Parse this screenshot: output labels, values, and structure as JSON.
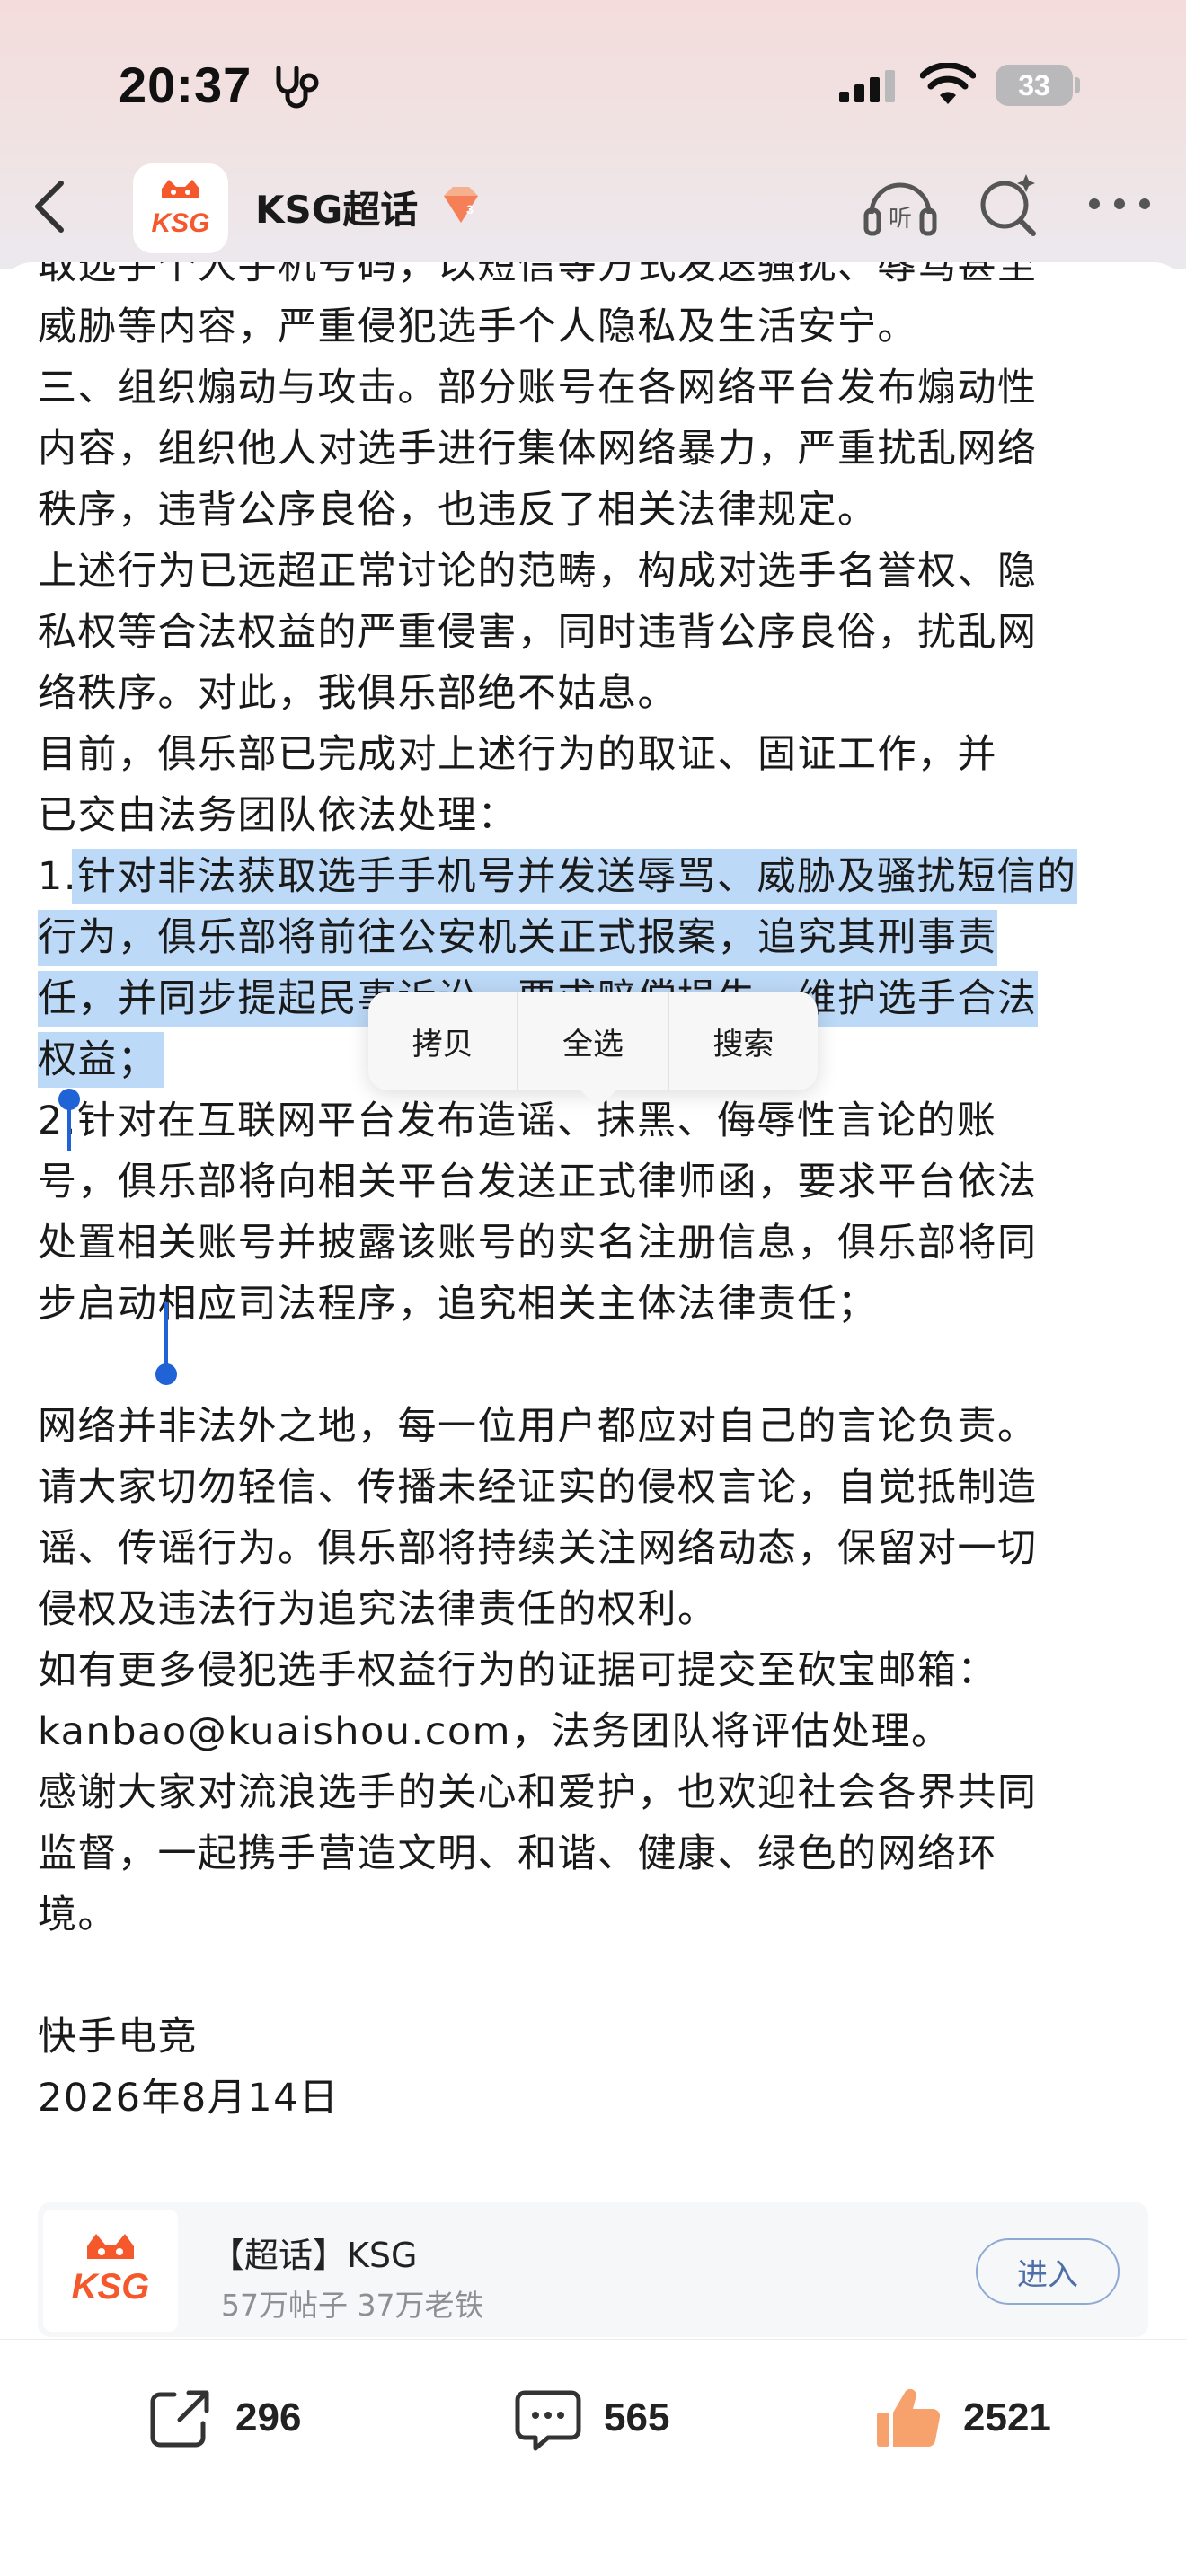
{
  "status_bar": {
    "time": "20:37",
    "battery": "33"
  },
  "nav": {
    "title": "KSG超话",
    "logo_text": "KSG",
    "icons": [
      "back-icon",
      "app-logo",
      "badge-icon",
      "listen-icon",
      "search-sparkle-icon",
      "more-icon"
    ]
  },
  "article": {
    "paragraphs": [
      "取选手个人手机号码，以短信等方式发送骚扰、辱骂甚至\n威胁等内容，严重侵犯选手个人隐私及生活安宁。",
      "三、组织煽动与攻击。部分账号在各网络平台发布煽动性\n内容，组织他人对选手进行集体网络暴力，严重扰乱网络\n秩序，违背公序良俗，也违反了相关法律规定。",
      "上述行为已远超正常讨论的范畴，构成对选手名誉权、隐\n私权等合法权益的严重侵害，同时违背公序良俗，扰乱网\n络秩序。对此，我俱乐部绝不姑息。",
      "目前，俱乐部已完成对上述行为的取证、固证工作，并\n已交由法务团队依法处理："
    ],
    "selected_prefix": "1.",
    "selected_text": "针对非法获取选手手机号并发送辱骂、威胁及骚扰短信的\n行为，俱乐部将前往公安机关正式报案，追究其刑事责\n任，并同步提起民事诉讼，要求赔偿损失，维护选手合法\n权益；",
    "paragraphs_after": [
      "2.针对在互联网平台发布造谣、抹黑、侮辱性言论的账\n号，俱乐部将向相关平台发送正式律师函，要求平台依法\n处置相关账号并披露该账号的实名注册信息，俱乐部将同\n步启动相应司法程序，追究相关主体法律责任；",
      "",
      "网络并非法外之地，每一位用户都应对自己的言论负责。\n请大家切勿轻信、传播未经证实的侵权言论，自觉抵制造\n谣、传谣行为。俱乐部将持续关注网络动态，保留对一切\n侵权及违法行为追究法律责任的权利。",
      "如有更多侵犯选手权益行为的证据可提交至砍宝邮箱：\nkanbao@kuaishou.com，法务团队将评估处理。",
      "感谢大家对流浪选手的关心和爱护，也欢迎社会各界共同\n监督，一起携手营造文明、和谐、健康、绿色的网络环\n境。",
      "",
      "快手电竞\n2026年8月14日"
    ]
  },
  "context_menu": {
    "items": [
      "拷贝",
      "全选",
      "搜索"
    ]
  },
  "topic_card": {
    "title": "【超话】KSG",
    "stats": "57万帖子 37万老铁",
    "enter_label": "进入",
    "logo_text": "KSG"
  },
  "actions": {
    "share_count": "296",
    "comment_count": "565",
    "like_count": "2521"
  },
  "colors": {
    "selection": "#bcd9f7",
    "handle": "#1f63d6",
    "brand_orange": "#f4582b",
    "like_orange": "#f7a26c"
  }
}
